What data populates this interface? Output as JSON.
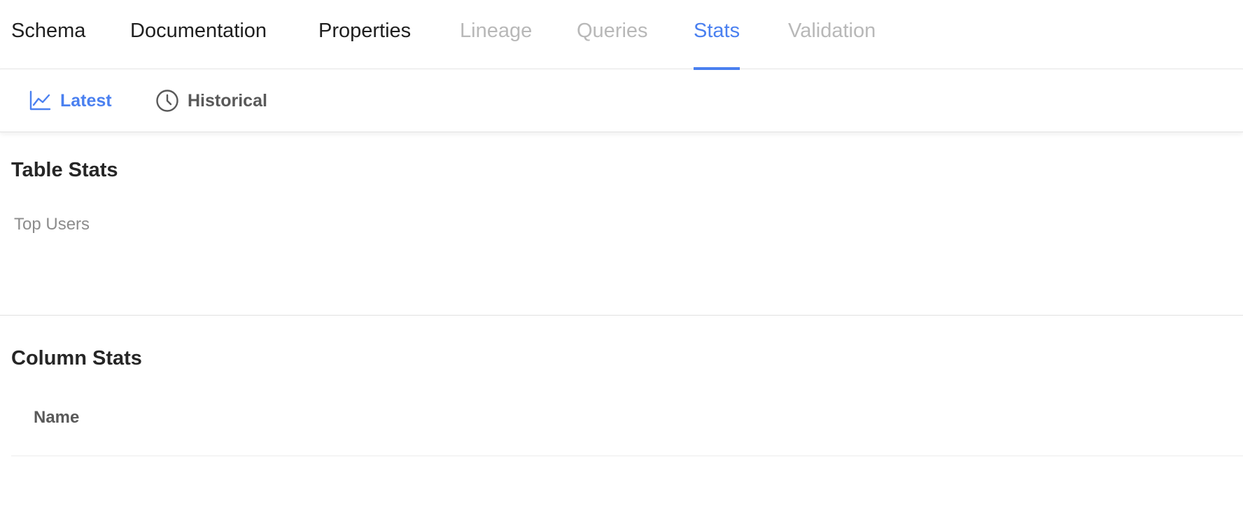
{
  "tabs": [
    {
      "label": "Schema",
      "state": "normal"
    },
    {
      "label": "Documentation",
      "state": "normal"
    },
    {
      "label": "Properties",
      "state": "normal"
    },
    {
      "label": "Lineage",
      "state": "disabled"
    },
    {
      "label": "Queries",
      "state": "disabled"
    },
    {
      "label": "Stats",
      "state": "active"
    },
    {
      "label": "Validation",
      "state": "disabled"
    }
  ],
  "subtabs": [
    {
      "label": "Latest",
      "icon": "line-chart-icon",
      "state": "active"
    },
    {
      "label": "Historical",
      "icon": "clock-icon",
      "state": "inactive"
    }
  ],
  "table_stats": {
    "title": "Table Stats",
    "top_users_label": "Top Users"
  },
  "column_stats": {
    "title": "Column Stats",
    "columns": [
      "Name"
    ]
  },
  "colors": {
    "accent": "#4a80f0",
    "disabled": "#b8b8b8"
  }
}
